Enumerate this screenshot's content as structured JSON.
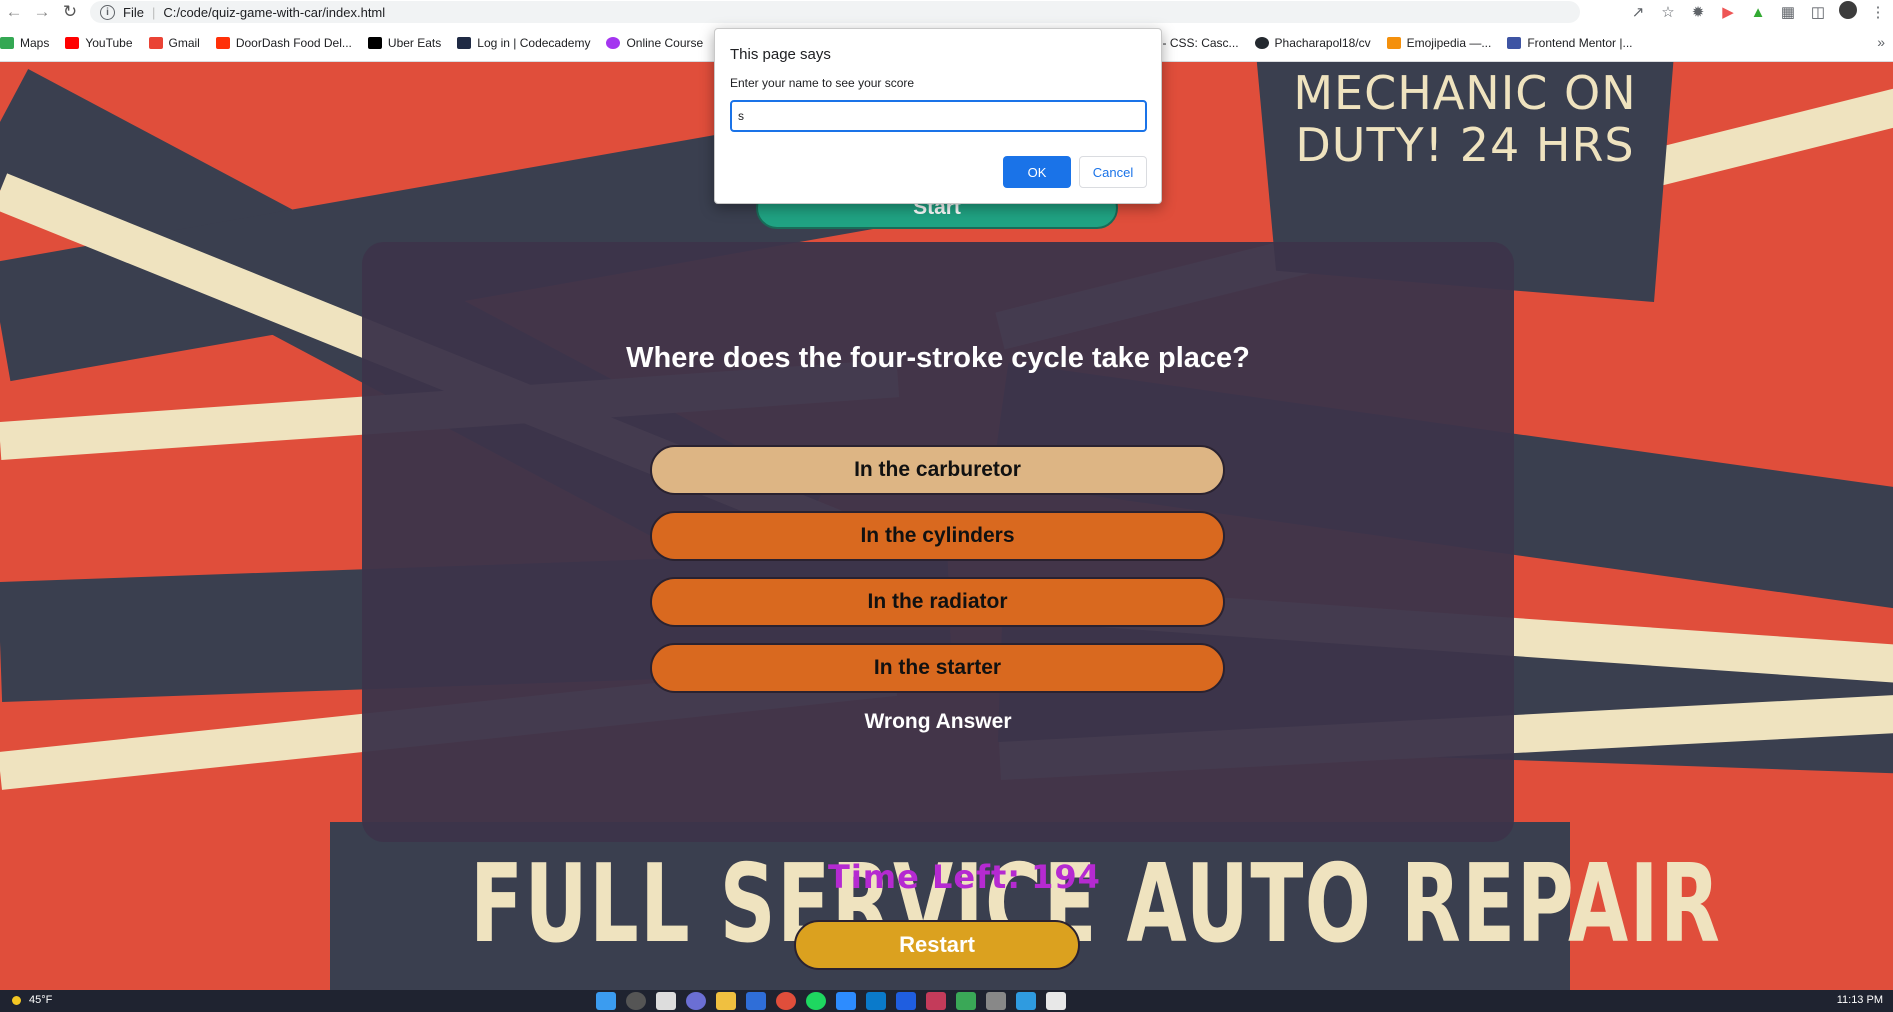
{
  "browser": {
    "url_scheme": "File",
    "url": "C:/code/quiz-game-with-car/index.html",
    "bookmarks": [
      {
        "label": "Maps",
        "color": "#34a853"
      },
      {
        "label": "YouTube",
        "color": "#ff0000"
      },
      {
        "label": "Gmail",
        "color": "#ea4335"
      },
      {
        "label": "DoorDash Food Del...",
        "color": "#ff3008"
      },
      {
        "label": "Uber Eats",
        "color": "#000000"
      },
      {
        "label": "Log in | Codecademy",
        "color": "#1f2a44"
      },
      {
        "label": "Online Course",
        "color": "#a435f0"
      },
      {
        "label": "<color> - CSS: Casc...",
        "color": "#000000"
      },
      {
        "label": "Phacharapol18/cv",
        "color": "#24292f"
      },
      {
        "label": "Emojipedia —...",
        "color": "#f4900c"
      },
      {
        "label": "Frontend Mentor |...",
        "color": "#3e54a3"
      }
    ]
  },
  "dialog": {
    "title": "This page says",
    "message": "Enter your name to see your score",
    "input_value": "s",
    "ok_label": "OK",
    "cancel_label": "Cancel"
  },
  "background": {
    "top_sign": "MECHANIC ON DUTY! 24 HRS",
    "bottom_banner": "FULL SERVICE AUTO REPAIR"
  },
  "quiz": {
    "start_label": "Start",
    "question": "Where does the four-stroke cycle take place?",
    "answers": [
      "In the carburetor",
      "In the cylinders",
      "In the radiator",
      "In the starter"
    ],
    "feedback": "Wrong Answer",
    "timer_label": "Time Left:",
    "timer_value": "194",
    "restart_label": "Restart"
  },
  "taskbar": {
    "weather": "45°F",
    "clock": "11:13 PM"
  }
}
